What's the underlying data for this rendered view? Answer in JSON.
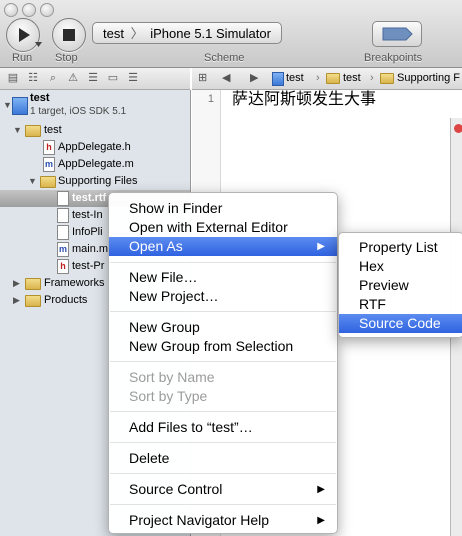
{
  "toolbar": {
    "run_label": "Run",
    "stop_label": "Stop",
    "scheme_target": "test",
    "scheme_separator": "〉",
    "scheme_destination": "iPhone 5.1 Simulator",
    "scheme_label": "Scheme",
    "breakpoints_label": "Breakpoints"
  },
  "navigator": {
    "project_name": "test",
    "project_subtitle": "1 target, iOS SDK 5.1",
    "items": [
      {
        "label": "test"
      },
      {
        "label": "AppDelegate.h"
      },
      {
        "label": "AppDelegate.m"
      },
      {
        "label": "Supporting Files"
      },
      {
        "label": "test.rtf"
      },
      {
        "label": "test-In"
      },
      {
        "label": "InfoPli"
      },
      {
        "label": "main.m"
      },
      {
        "label": "test-Pr"
      },
      {
        "label": "Frameworks"
      },
      {
        "label": "Products"
      }
    ]
  },
  "jump_bar": {
    "crumbs": [
      "test",
      "test",
      "Supporting F"
    ]
  },
  "editor": {
    "line_number": "1",
    "content": "萨达阿斯顿发生大事"
  },
  "context_menu": {
    "items": [
      {
        "label": "Show in Finder"
      },
      {
        "label": "Open with External Editor"
      },
      {
        "label": "Open As"
      },
      {
        "label": "New File…"
      },
      {
        "label": "New Project…"
      },
      {
        "label": "New Group"
      },
      {
        "label": "New Group from Selection"
      },
      {
        "label": "Sort by Name"
      },
      {
        "label": "Sort by Type"
      },
      {
        "label": "Add Files to “test”…"
      },
      {
        "label": "Delete"
      },
      {
        "label": "Source Control"
      },
      {
        "label": "Project Navigator Help"
      }
    ]
  },
  "submenu": {
    "items": [
      {
        "label": "Property List"
      },
      {
        "label": "Hex"
      },
      {
        "label": "Preview"
      },
      {
        "label": "RTF"
      },
      {
        "label": "Source Code"
      }
    ]
  },
  "colors": {
    "highlight": "#3a6ee8",
    "navigator_bg": "#dee4ea"
  }
}
